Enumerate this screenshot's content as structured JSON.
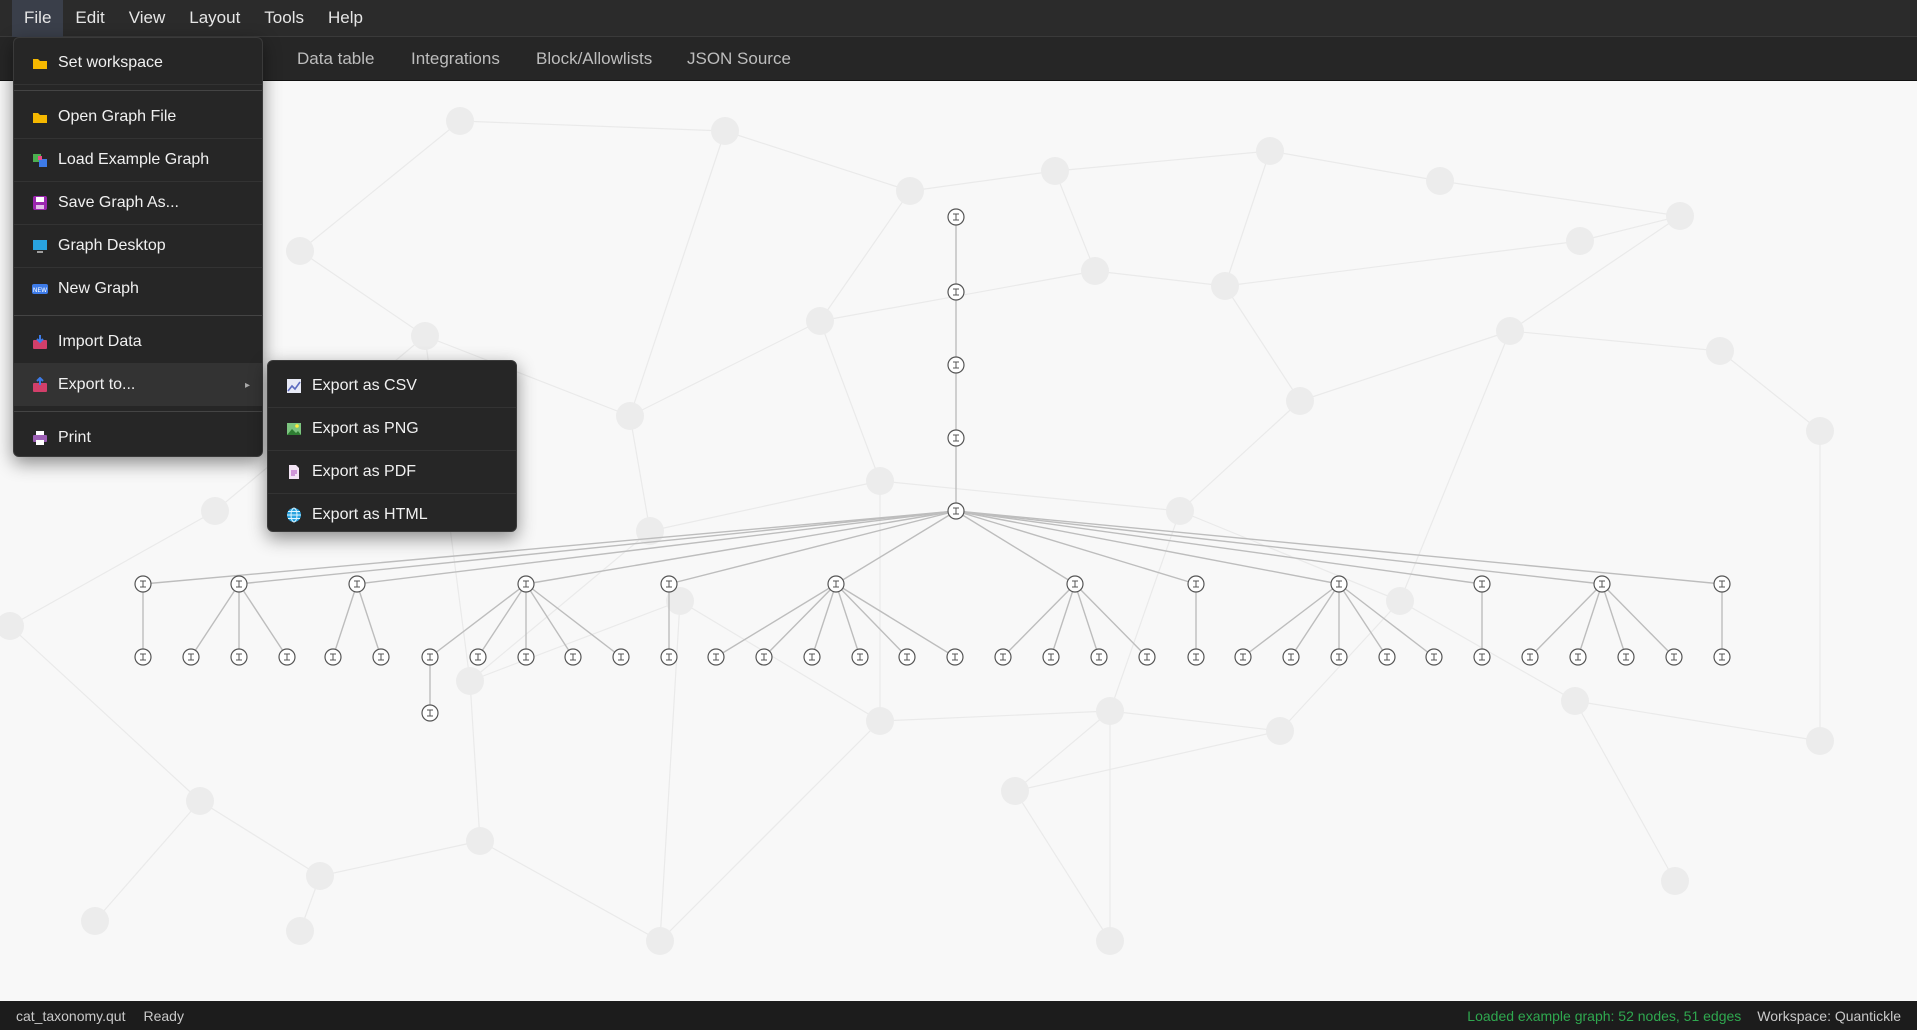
{
  "menubar": {
    "items": [
      {
        "label": "File",
        "active": true
      },
      {
        "label": "Edit"
      },
      {
        "label": "View"
      },
      {
        "label": "Layout"
      },
      {
        "label": "Tools"
      },
      {
        "label": "Help"
      }
    ]
  },
  "tabs": [
    {
      "label": "Data table"
    },
    {
      "label": "Integrations"
    },
    {
      "label": "Block/Allowlists"
    },
    {
      "label": "JSON Source"
    }
  ],
  "file_menu": {
    "items": [
      {
        "label": "Set workspace",
        "icon": "folder-icon",
        "color": "#f5b800"
      },
      {
        "label": "Open Graph File",
        "icon": "folder-icon",
        "color": "#f5b800"
      },
      {
        "label": "Load Example Graph",
        "icon": "example-graph-icon",
        "color": "#4caf50"
      },
      {
        "label": "Save Graph As...",
        "icon": "floppy-disk-icon",
        "color": "#9c27b0"
      },
      {
        "label": "Graph Desktop",
        "icon": "monitor-icon",
        "color": "#29a3e0"
      },
      {
        "label": "New Graph",
        "icon": "new-badge-icon",
        "color": "#3d7be8"
      },
      {
        "label": "Import Data",
        "icon": "inbox-import-icon",
        "color": "#d23f6a"
      },
      {
        "label": "Export to...",
        "icon": "outbox-export-icon",
        "color": "#d23f6a"
      },
      {
        "label": "Print",
        "icon": "printer-icon",
        "color": "#9c5fb5"
      }
    ]
  },
  "export_menu": {
    "items": [
      {
        "label": "Export as CSV",
        "icon": "chart-line-icon"
      },
      {
        "label": "Export as PNG",
        "icon": "image-icon"
      },
      {
        "label": "Export as PDF",
        "icon": "document-icon"
      },
      {
        "label": "Export as HTML",
        "icon": "globe-icon"
      }
    ]
  },
  "statusbar": {
    "filename": "cat_taxonomy.qut",
    "state": "Ready",
    "message": "Loaded example graph: 52 nodes, 51 edges",
    "workspace": "Workspace: Quantickle"
  },
  "colors": {
    "menubar_bg": "#2b2b2b",
    "menu_bg": "#262626",
    "status_ok": "#2fa84f",
    "canvas_bg": "#f8f8f8",
    "edge": "#bdbdbd"
  }
}
